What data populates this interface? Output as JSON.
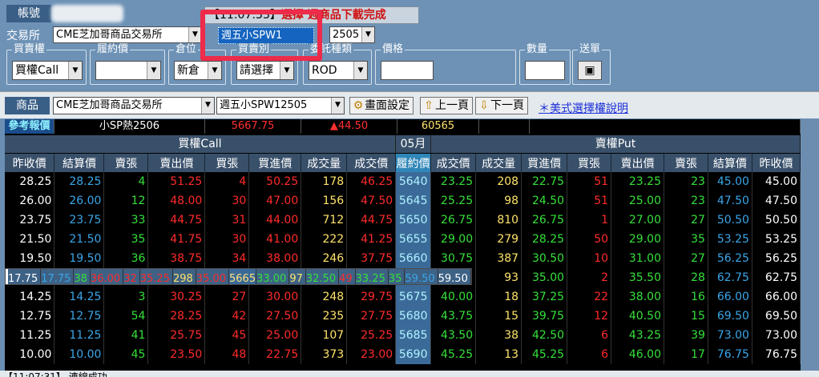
{
  "account": {
    "label": "帳號"
  },
  "status": {
    "time": "【11:07:33】",
    "message": "選擇 週商品下載完成"
  },
  "exchange": {
    "label": "交易所",
    "value": "CME芝加哥商品交易所",
    "product": "週五小SPW1",
    "month": "2505"
  },
  "order": {
    "buysell": {
      "caption": "買賣權",
      "value": "買權Call"
    },
    "strike": {
      "caption": "履約價",
      "value": ""
    },
    "position": {
      "caption": "倉位",
      "value": "新倉"
    },
    "side": {
      "caption": "買賣別",
      "value": "請選擇"
    },
    "ordtype": {
      "caption": "委託種類",
      "value": "ROD"
    },
    "price": {
      "caption": "價格",
      "value": ""
    },
    "qty": {
      "caption": "數量",
      "value": ""
    },
    "send": {
      "caption": "送單",
      "icon": "document-icon"
    }
  },
  "product_bar": {
    "label": "商品",
    "exchange": "CME芝加哥商品交易所",
    "product": "週五小SPW12505",
    "settings_btn": "畫面設定",
    "prev_btn": "上一頁",
    "next_btn": "下一頁",
    "help_link": "＊美式選擇權說明"
  },
  "reference": {
    "label": "參考報價",
    "name": "小SP熱2506",
    "price": "5667.75",
    "change": "▲44.50",
    "volume": "60565"
  },
  "table": {
    "call_header": "買權Call",
    "month_header": "05月",
    "put_header": "賣權Put",
    "columns": [
      "昨收價",
      "結算價",
      "賣張",
      "賣出價",
      "買張",
      "買進價",
      "成交量",
      "成交價",
      "履約價",
      "成交價",
      "成交量",
      "買進價",
      "買張",
      "賣出價",
      "賣張",
      "結算價",
      "昨收價"
    ],
    "rows": [
      [
        "28.25",
        "28.25",
        "4",
        "51.25",
        "4",
        "50.25",
        "178",
        "46.25",
        "5640",
        "23.25",
        "208",
        "22.75",
        "51",
        "23.25",
        "23",
        "45.00",
        "45.00"
      ],
      [
        "26.00",
        "26.00",
        "12",
        "48.00",
        "30",
        "47.00",
        "156",
        "47.50",
        "5645",
        "25.25",
        "98",
        "24.50",
        "51",
        "25.00",
        "23",
        "47.50",
        "47.50"
      ],
      [
        "23.75",
        "23.75",
        "33",
        "44.75",
        "31",
        "44.00",
        "712",
        "44.75",
        "5650",
        "26.75",
        "810",
        "26.75",
        "1",
        "27.00",
        "27",
        "50.50",
        "50.50"
      ],
      [
        "21.50",
        "21.50",
        "35",
        "41.75",
        "30",
        "41.00",
        "222",
        "41.25",
        "5655",
        "29.00",
        "279",
        "28.25",
        "50",
        "29.00",
        "35",
        "53.25",
        "53.25"
      ],
      [
        "19.50",
        "19.50",
        "36",
        "38.75",
        "34",
        "38.00",
        "246",
        "37.75",
        "5660",
        "30.75",
        "387",
        "30.50",
        "10",
        "31.00",
        "27",
        "56.25",
        "56.25"
      ],
      [
        "17.75",
        "17.75",
        "38",
        "36.00",
        "32",
        "35.25",
        "298",
        "35.00",
        "5665",
        "33.00",
        "97",
        "32.50",
        "49",
        "33.25",
        "35",
        "59.50",
        "59.50"
      ],
      [
        "16.00",
        "16.00",
        "40",
        "33.25",
        "42",
        "32.50",
        "163",
        "32.50",
        "5670",
        "35.25",
        "93",
        "35.00",
        "2",
        "35.50",
        "28",
        "62.75",
        "62.75"
      ],
      [
        "14.25",
        "14.25",
        "3",
        "30.25",
        "27",
        "30.00",
        "248",
        "29.75",
        "5675",
        "40.00",
        "18",
        "37.25",
        "22",
        "38.00",
        "16",
        "66.00",
        "66.00"
      ],
      [
        "12.75",
        "12.75",
        "54",
        "28.25",
        "42",
        "27.50",
        "235",
        "27.75",
        "5680",
        "43.75",
        "15",
        "39.75",
        "12",
        "40.50",
        "15",
        "69.50",
        "69.50"
      ],
      [
        "11.25",
        "11.25",
        "41",
        "25.75",
        "45",
        "25.00",
        "107",
        "25.25",
        "5685",
        "43.50",
        "38",
        "42.50",
        "6",
        "43.25",
        "39",
        "73.00",
        "73.00"
      ],
      [
        "10.00",
        "10.00",
        "45",
        "23.50",
        "48",
        "22.75",
        "373",
        "23.00",
        "5690",
        "45.25",
        "13",
        "45.25",
        "6",
        "46.00",
        "17",
        "76.75",
        "76.75"
      ]
    ],
    "selected_row": 5
  },
  "bottom_status": "【11:07:31】 連線成功"
}
